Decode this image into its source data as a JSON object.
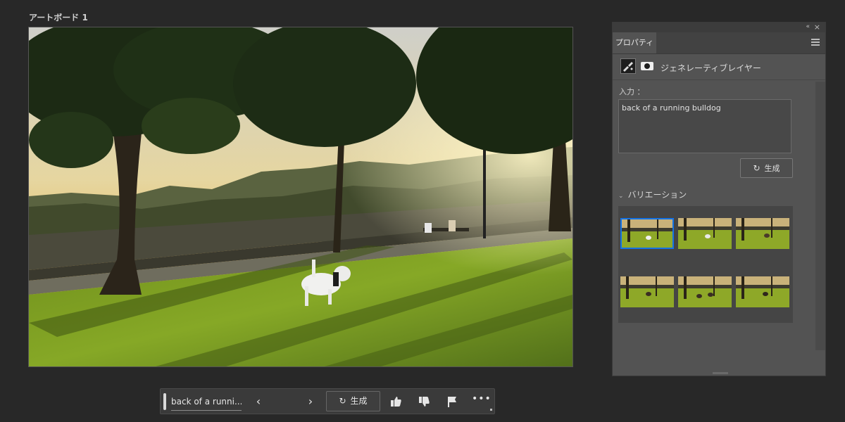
{
  "artboard": {
    "title": "アートボード 1"
  },
  "properties_panel": {
    "tab_label": "プロパティ",
    "layer_type": "ジェネレーティブレイヤー",
    "prompt_label": "入力 ：",
    "prompt_value": "back of a running bulldog",
    "generate_label": "生成",
    "variations_label": "バリエーション",
    "variation_count": 6,
    "selected_variation": 1
  },
  "taskbar": {
    "prompt_value": "back of a runni...",
    "generate_label": "生成"
  },
  "colors": {
    "selection": "#1473e6",
    "panel": "#535353",
    "background": "#282828"
  },
  "icons": [
    "collapse-icon",
    "close-icon",
    "menu-icon",
    "brush-icon",
    "mask-icon",
    "regenerate-icon",
    "chevron-down-icon",
    "chevron-left-icon",
    "chevron-right-icon",
    "thumbs-up-icon",
    "thumbs-down-icon",
    "flag-icon",
    "more-icon"
  ]
}
